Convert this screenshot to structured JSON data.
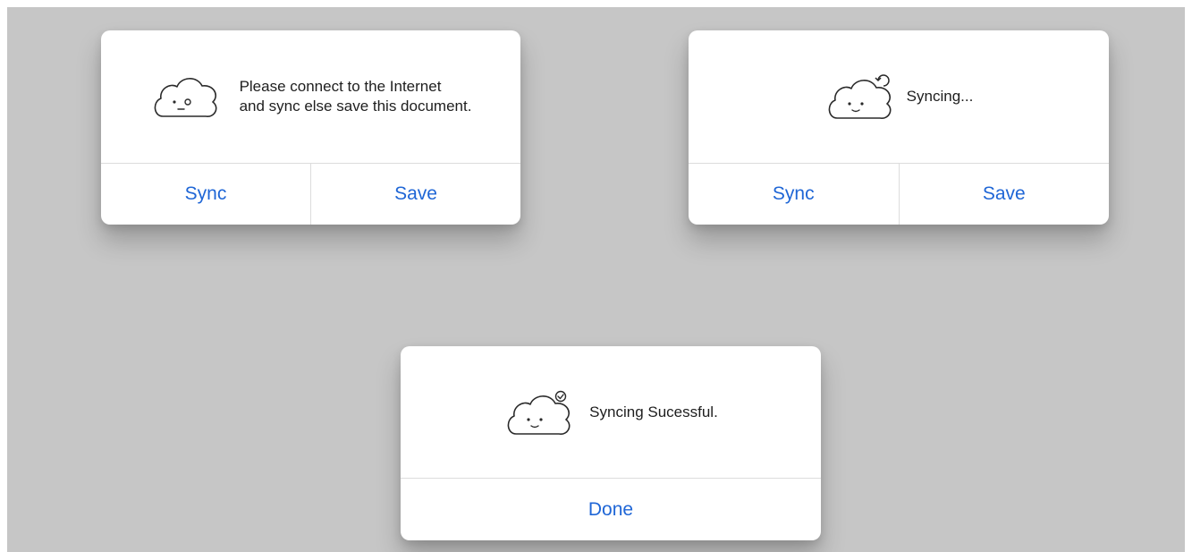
{
  "dialogs": {
    "offline": {
      "message_line1": "Please connect to the Internet",
      "message_line2": "and sync else save this document.",
      "sync_label": "Sync",
      "save_label": "Save"
    },
    "syncing": {
      "message": "Syncing...",
      "sync_label": "Sync",
      "save_label": "Save"
    },
    "success": {
      "message": "Syncing Sucessful.",
      "done_label": "Done"
    }
  },
  "icons": {
    "offline": "cloud-face-icon",
    "syncing": "cloud-sync-icon",
    "success": "cloud-check-icon"
  },
  "colors": {
    "background": "#c6c6c6",
    "dialog": "#ffffff",
    "button_text": "#1f66d6",
    "separator": "#dcdcdc"
  }
}
